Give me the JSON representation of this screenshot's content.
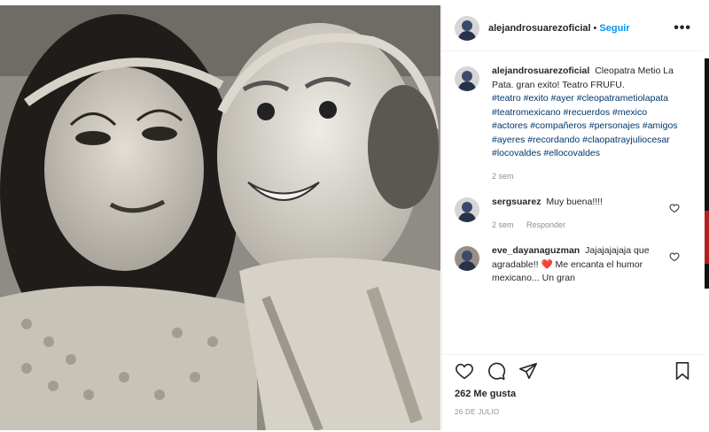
{
  "post": {
    "username": "alejandrosuarezoficial",
    "separator": "•",
    "follow_label": "Seguir",
    "more_label": "•••",
    "caption": {
      "username": "alejandrosuarezoficial",
      "text": "Cleopatra Metio La Pata. gran exito! Teatro FRUFU.",
      "hashtags": "#teatro #exito #ayer #cleopatrametiolapata #teatromexicano #recuerdos #mexico #actores #compañeros #personajes #amigos #ayeres #recordando #claopatrayjuliocesar #locovaldes #ellocovaldes",
      "time": "2 sem"
    },
    "comments": [
      {
        "username": "sergsuarez",
        "text": "Muy buena!!!!",
        "time": "2 sem",
        "reply": "Responder"
      },
      {
        "username": "eve_dayanaguzman",
        "text": "Jajajajajaja que agradable!! ❤️ Me encanta el humor mexicano... Un gran"
      }
    ],
    "likes": "262 Me gusta",
    "date": "26 DE JULIO"
  },
  "icons": {
    "like": "heart-icon",
    "comment": "comment-icon",
    "share": "paper-plane-icon",
    "save": "bookmark-icon",
    "comment_like": "heart-icon"
  },
  "colors": {
    "link": "#0095f6",
    "hashtag": "#00376b",
    "muted": "#8e8e8e",
    "heart": "#ed4956"
  }
}
